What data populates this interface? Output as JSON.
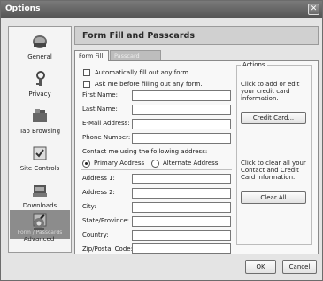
{
  "window": {
    "title": "Options",
    "close_icon": "close-icon"
  },
  "sidebar": {
    "items": [
      {
        "label": "General",
        "icon": "general-icon"
      },
      {
        "label": "Privacy",
        "icon": "privacy-icon"
      },
      {
        "label": "Tab Browsing",
        "icon": "tab-browsing-icon"
      },
      {
        "label": "Site Controls",
        "icon": "site-controls-icon"
      },
      {
        "label": "Downloads",
        "icon": "downloads-icon"
      },
      {
        "label": "Form / Passcards",
        "icon": "form-passcards-icon",
        "selected": true
      },
      {
        "label": "Advanced",
        "icon": "advanced-icon"
      }
    ]
  },
  "panel": {
    "title": "Form Fill and Passcards",
    "tabs": [
      "Form Fill",
      "Passcard Manager"
    ],
    "options": {
      "auto_fill": "Automatically fill out any form.",
      "ask_before": "Ask me before filling out any form."
    },
    "fields_top": [
      "First Name:",
      "Last Name:",
      "E-Mail Address:",
      "Phone Number:"
    ],
    "contact_label": "Contact me using the following address:",
    "address_choice": {
      "primary": "Primary Address",
      "alternate": "Alternate Address"
    },
    "fields_address": [
      "Address 1:",
      "Address 2:",
      "City:",
      "State/Province:",
      "Country:",
      "Zip/Postal Code:"
    ],
    "actions": {
      "legend": "Actions",
      "credit_text": "Click to add or edit your credit card information.",
      "credit_button": "Credit Card...",
      "clear_text": "Click to clear all your Contact and Credit Card information.",
      "clear_button": "Clear All"
    }
  },
  "footer": {
    "ok": "OK",
    "cancel": "Cancel"
  }
}
